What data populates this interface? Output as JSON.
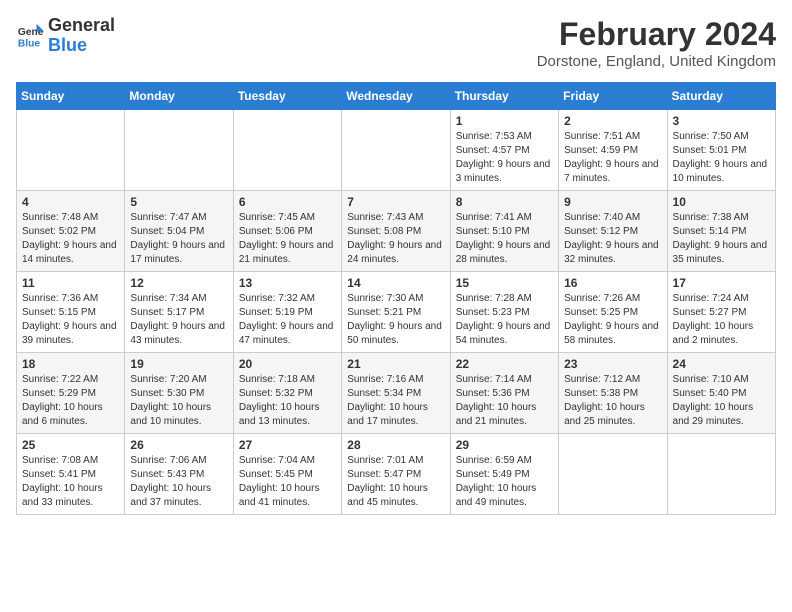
{
  "header": {
    "logo_line1": "General",
    "logo_line2": "Blue",
    "month": "February 2024",
    "location": "Dorstone, England, United Kingdom"
  },
  "weekdays": [
    "Sunday",
    "Monday",
    "Tuesday",
    "Wednesday",
    "Thursday",
    "Friday",
    "Saturday"
  ],
  "weeks": [
    [
      {
        "day": "",
        "info": ""
      },
      {
        "day": "",
        "info": ""
      },
      {
        "day": "",
        "info": ""
      },
      {
        "day": "",
        "info": ""
      },
      {
        "day": "1",
        "info": "Sunrise: 7:53 AM\nSunset: 4:57 PM\nDaylight: 9 hours and 3 minutes."
      },
      {
        "day": "2",
        "info": "Sunrise: 7:51 AM\nSunset: 4:59 PM\nDaylight: 9 hours and 7 minutes."
      },
      {
        "day": "3",
        "info": "Sunrise: 7:50 AM\nSunset: 5:01 PM\nDaylight: 9 hours and 10 minutes."
      }
    ],
    [
      {
        "day": "4",
        "info": "Sunrise: 7:48 AM\nSunset: 5:02 PM\nDaylight: 9 hours and 14 minutes."
      },
      {
        "day": "5",
        "info": "Sunrise: 7:47 AM\nSunset: 5:04 PM\nDaylight: 9 hours and 17 minutes."
      },
      {
        "day": "6",
        "info": "Sunrise: 7:45 AM\nSunset: 5:06 PM\nDaylight: 9 hours and 21 minutes."
      },
      {
        "day": "7",
        "info": "Sunrise: 7:43 AM\nSunset: 5:08 PM\nDaylight: 9 hours and 24 minutes."
      },
      {
        "day": "8",
        "info": "Sunrise: 7:41 AM\nSunset: 5:10 PM\nDaylight: 9 hours and 28 minutes."
      },
      {
        "day": "9",
        "info": "Sunrise: 7:40 AM\nSunset: 5:12 PM\nDaylight: 9 hours and 32 minutes."
      },
      {
        "day": "10",
        "info": "Sunrise: 7:38 AM\nSunset: 5:14 PM\nDaylight: 9 hours and 35 minutes."
      }
    ],
    [
      {
        "day": "11",
        "info": "Sunrise: 7:36 AM\nSunset: 5:15 PM\nDaylight: 9 hours and 39 minutes."
      },
      {
        "day": "12",
        "info": "Sunrise: 7:34 AM\nSunset: 5:17 PM\nDaylight: 9 hours and 43 minutes."
      },
      {
        "day": "13",
        "info": "Sunrise: 7:32 AM\nSunset: 5:19 PM\nDaylight: 9 hours and 47 minutes."
      },
      {
        "day": "14",
        "info": "Sunrise: 7:30 AM\nSunset: 5:21 PM\nDaylight: 9 hours and 50 minutes."
      },
      {
        "day": "15",
        "info": "Sunrise: 7:28 AM\nSunset: 5:23 PM\nDaylight: 9 hours and 54 minutes."
      },
      {
        "day": "16",
        "info": "Sunrise: 7:26 AM\nSunset: 5:25 PM\nDaylight: 9 hours and 58 minutes."
      },
      {
        "day": "17",
        "info": "Sunrise: 7:24 AM\nSunset: 5:27 PM\nDaylight: 10 hours and 2 minutes."
      }
    ],
    [
      {
        "day": "18",
        "info": "Sunrise: 7:22 AM\nSunset: 5:29 PM\nDaylight: 10 hours and 6 minutes."
      },
      {
        "day": "19",
        "info": "Sunrise: 7:20 AM\nSunset: 5:30 PM\nDaylight: 10 hours and 10 minutes."
      },
      {
        "day": "20",
        "info": "Sunrise: 7:18 AM\nSunset: 5:32 PM\nDaylight: 10 hours and 13 minutes."
      },
      {
        "day": "21",
        "info": "Sunrise: 7:16 AM\nSunset: 5:34 PM\nDaylight: 10 hours and 17 minutes."
      },
      {
        "day": "22",
        "info": "Sunrise: 7:14 AM\nSunset: 5:36 PM\nDaylight: 10 hours and 21 minutes."
      },
      {
        "day": "23",
        "info": "Sunrise: 7:12 AM\nSunset: 5:38 PM\nDaylight: 10 hours and 25 minutes."
      },
      {
        "day": "24",
        "info": "Sunrise: 7:10 AM\nSunset: 5:40 PM\nDaylight: 10 hours and 29 minutes."
      }
    ],
    [
      {
        "day": "25",
        "info": "Sunrise: 7:08 AM\nSunset: 5:41 PM\nDaylight: 10 hours and 33 minutes."
      },
      {
        "day": "26",
        "info": "Sunrise: 7:06 AM\nSunset: 5:43 PM\nDaylight: 10 hours and 37 minutes."
      },
      {
        "day": "27",
        "info": "Sunrise: 7:04 AM\nSunset: 5:45 PM\nDaylight: 10 hours and 41 minutes."
      },
      {
        "day": "28",
        "info": "Sunrise: 7:01 AM\nSunset: 5:47 PM\nDaylight: 10 hours and 45 minutes."
      },
      {
        "day": "29",
        "info": "Sunrise: 6:59 AM\nSunset: 5:49 PM\nDaylight: 10 hours and 49 minutes."
      },
      {
        "day": "",
        "info": ""
      },
      {
        "day": "",
        "info": ""
      }
    ]
  ]
}
